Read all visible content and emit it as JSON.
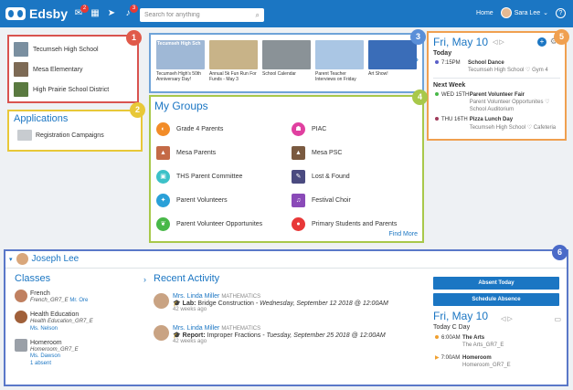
{
  "topbar": {
    "brand": "Edsby",
    "mail_badge": "2",
    "notif_badge": "3",
    "search_placeholder": "Search for anything",
    "home_label": "Home",
    "user_name": "Sara Lee",
    "user_caret": "⌄",
    "help": "?"
  },
  "schools": [
    {
      "name": "Tecumseh High School",
      "color": "#7a8fa0"
    },
    {
      "name": "Mesa Elementary",
      "color": "#7d6a55"
    },
    {
      "name": "High Prairie School District",
      "color": "#5a7a40"
    }
  ],
  "apps": {
    "title": "Applications",
    "items": [
      {
        "label": "Registration Campaigns"
      }
    ]
  },
  "news": {
    "items": [
      {
        "caption": "Tecumseh High's 50th Anniversary Day!",
        "color": "#9fb8d6",
        "overlay": "Tecumseh High Sch"
      },
      {
        "caption": "Annual 5k Fun Run For Funds - May 3",
        "color": "#c8b388"
      },
      {
        "caption": "School Calendar",
        "color": "#8a9297"
      },
      {
        "caption": "Parent Teacher Interviews on Friday",
        "color": "#aac6e4"
      },
      {
        "caption": "Art Show!",
        "color": "#3a6db8"
      }
    ],
    "arrow": "›"
  },
  "groups": {
    "title": "My Groups",
    "left": [
      {
        "name": "Grade 4 Parents",
        "color": "#f28c28",
        "icon": "◐"
      },
      {
        "name": "Mesa Parents",
        "color": "#c46a46",
        "icon": "▲"
      },
      {
        "name": "THS Parent Committee",
        "color": "#3cc1c8",
        "icon": "▣"
      },
      {
        "name": "Parent Volunteers",
        "color": "#2aa0d8",
        "icon": "✦"
      },
      {
        "name": "Parent Volunteer Opportunites",
        "color": "#48b848",
        "icon": "❦"
      }
    ],
    "right": [
      {
        "name": "PIAC",
        "color": "#e040a0",
        "icon": "☗"
      },
      {
        "name": "Mesa PSC",
        "color": "#7a5a40",
        "icon": "▲"
      },
      {
        "name": "Lost & Found",
        "color": "#4a4a80",
        "icon": "✎"
      },
      {
        "name": "Festival Choir",
        "color": "#8a4ab8",
        "icon": "♫"
      },
      {
        "name": "Primary Students and Parents",
        "color": "#e83838",
        "icon": "●"
      }
    ],
    "find_more": "Find More"
  },
  "calendar": {
    "date": "Fri, May 10",
    "nav": "◁ ▷",
    "plus": "+",
    "gear": "⚙",
    "today_label": "Today",
    "today_events": [
      {
        "time": "7:15PM",
        "title": "School Dance",
        "sub": "Tecumseh High School ♡ Gym 4",
        "color": "#5a5fc8"
      }
    ],
    "next_label": "Next Week",
    "next_events": [
      {
        "time": "WED 15TH",
        "title": "Parent Volunteer Fair",
        "sub": "Parent Volunteer Opportunites ♡ School Auditorium",
        "color": "#48b848"
      },
      {
        "time": "THU 16TH",
        "title": "Pizza Lunch Day",
        "sub": "Tecumseh High School ♡ Cafeteria",
        "color": "#a03a5a"
      }
    ]
  },
  "numbers": [
    {
      "n": "1",
      "color": "#e05a4a"
    },
    {
      "n": "2",
      "color": "#e8c838"
    },
    {
      "n": "3",
      "color": "#5a8fd8"
    },
    {
      "n": "4",
      "color": "#a8c84a"
    },
    {
      "n": "5",
      "color": "#f0a050"
    },
    {
      "n": "6",
      "color": "#4a6ac8"
    }
  ],
  "student": {
    "caret": "▾",
    "name": "Joseph Lee",
    "classes_title": "Classes",
    "classes_chev": "›",
    "classes": [
      {
        "name": "French",
        "code": "French_GR7_E",
        "teacher": "Mr. Ore",
        "color": "#c08060",
        "extra": ""
      },
      {
        "name": "Health Education",
        "code": "Health Education_GR7_E",
        "teacher": "Ms. Nelson",
        "color": "#a0603a",
        "extra": ""
      },
      {
        "name": "Homeroom",
        "code": "Homeroom_GR7_E",
        "teacher": "Ms. Dawson",
        "color": "#9aa0a8",
        "extra": "1 absent"
      }
    ],
    "activity_title": "Recent Activity",
    "activity": [
      {
        "teacher": "Mrs. Linda Miller",
        "subject": "MATHEMATICS",
        "type": "Lab:",
        "desc": "Bridge Construction",
        "due": "- Wednesday, September 12 2018 @ 12:00AM",
        "ago": "42 weeks ago"
      },
      {
        "teacher": "Mrs. Linda Miller",
        "subject": "MATHEMATICS",
        "type": "Report:",
        "desc": "Improper Fractions",
        "due": "- Tuesday, September 25 2018 @ 12:00AM",
        "ago": "42 weeks ago"
      }
    ],
    "absent_btn": "Absent Today",
    "schedule_btn": "Schedule Absence",
    "date": "Fri, May 10",
    "nav": "◁ ▷",
    "today_line": "Today   C Day",
    "events": [
      {
        "time": "6:00AM",
        "title": "The Arts",
        "sub": "The Arts_GR7_E",
        "color": "#f0a030"
      },
      {
        "time": "7:00AM",
        "title": "Homeroom",
        "sub": "Homeroom_GR7_E",
        "color": "#f0a030"
      }
    ]
  }
}
